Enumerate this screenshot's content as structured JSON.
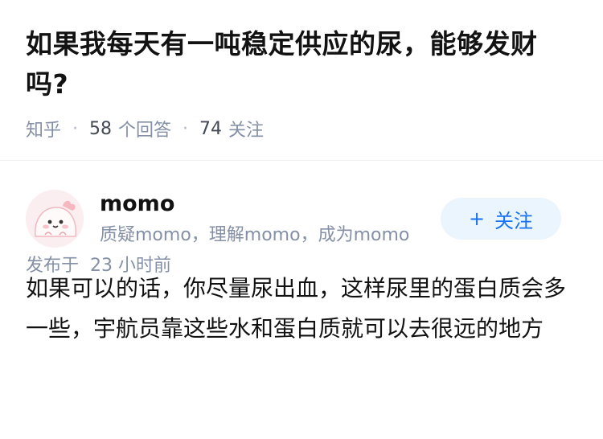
{
  "question": {
    "title": "如果我每天有一吨稳定供应的尿，能够发财吗?",
    "source": "知乎",
    "separator": "·",
    "answer_count": "58",
    "answer_count_label": "个回答",
    "follower_count": "74",
    "follower_count_label": "关注"
  },
  "answer": {
    "author": {
      "name": "momo",
      "bio": "质疑momo，理解momo，成为momo",
      "avatar_icon": "cute-blob-avatar-icon"
    },
    "follow_button": {
      "plus": "+",
      "label": "关注"
    },
    "content": "如果可以的话，你尽量尿出血，这样尿里的蛋白质会多一些，宇航员靠这些水和蛋白质就可以去很远的地方",
    "published_label": "发布于",
    "published_count": "23",
    "published_unit": "小时前"
  },
  "colors": {
    "title": "#121212",
    "meta": "#8590a6",
    "accent": "#1772f6",
    "follow_bg": "#ebf5fd"
  }
}
